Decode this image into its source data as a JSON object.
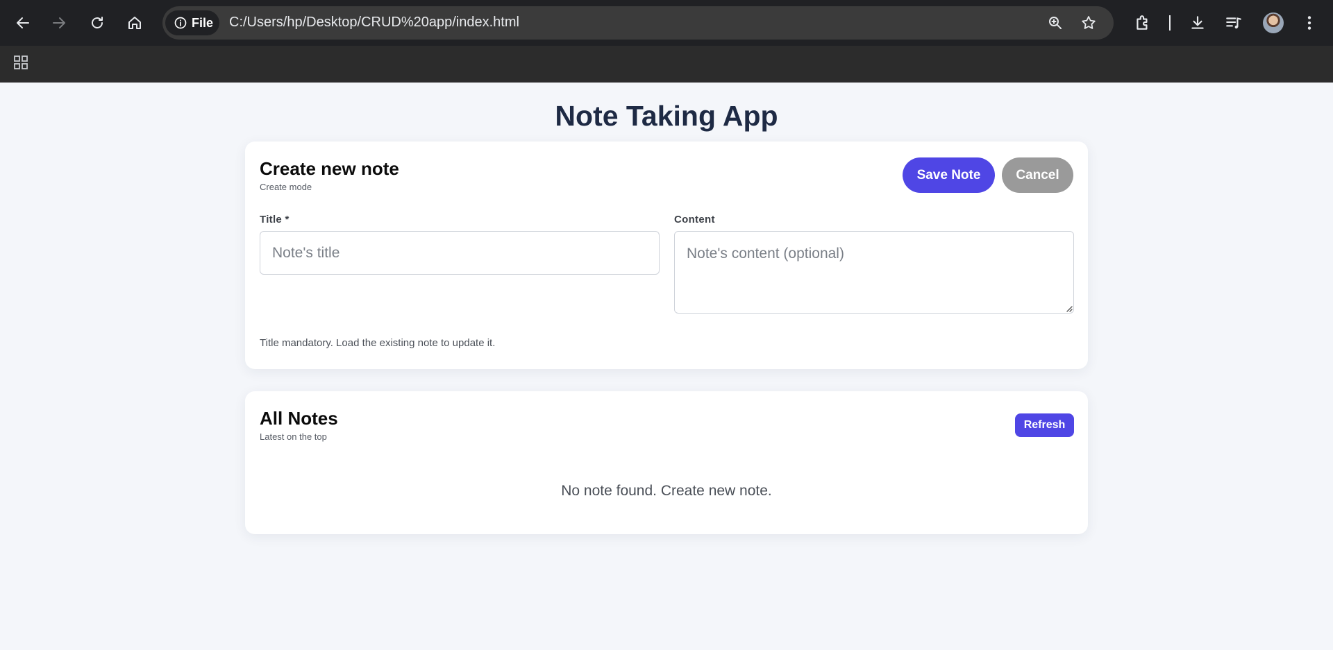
{
  "browser": {
    "chip_label": "File",
    "url": "C:/Users/hp/Desktop/CRUD%20app/index.html",
    "icons": [
      "back-icon",
      "forward-icon",
      "reload-icon",
      "home-icon",
      "info-icon",
      "zoom-icon",
      "star-icon",
      "extensions-icon",
      "download-icon",
      "media-icon",
      "avatar",
      "more-icon",
      "apps-icon"
    ]
  },
  "page": {
    "title": "Note Taking App"
  },
  "create_card": {
    "title": "Create new note",
    "subtitle": "Create mode",
    "save_label": "Save Note",
    "cancel_label": "Cancel",
    "title_label": "Title *",
    "title_placeholder": "Note's title",
    "title_value": "",
    "content_label": "Content",
    "content_placeholder": "Note's content (optional)",
    "content_value": "",
    "hint": "Title mandatory. Load the existing note to update it."
  },
  "list_card": {
    "title": "All Notes",
    "subtitle": "Latest on the top",
    "refresh_label": "Refresh",
    "empty_message": "No note found. Create new note."
  },
  "colors": {
    "accent": "#4f46e5",
    "cancel": "#9a9a9a",
    "page_bg": "#f4f6fa",
    "title_text": "#1e2a44"
  }
}
